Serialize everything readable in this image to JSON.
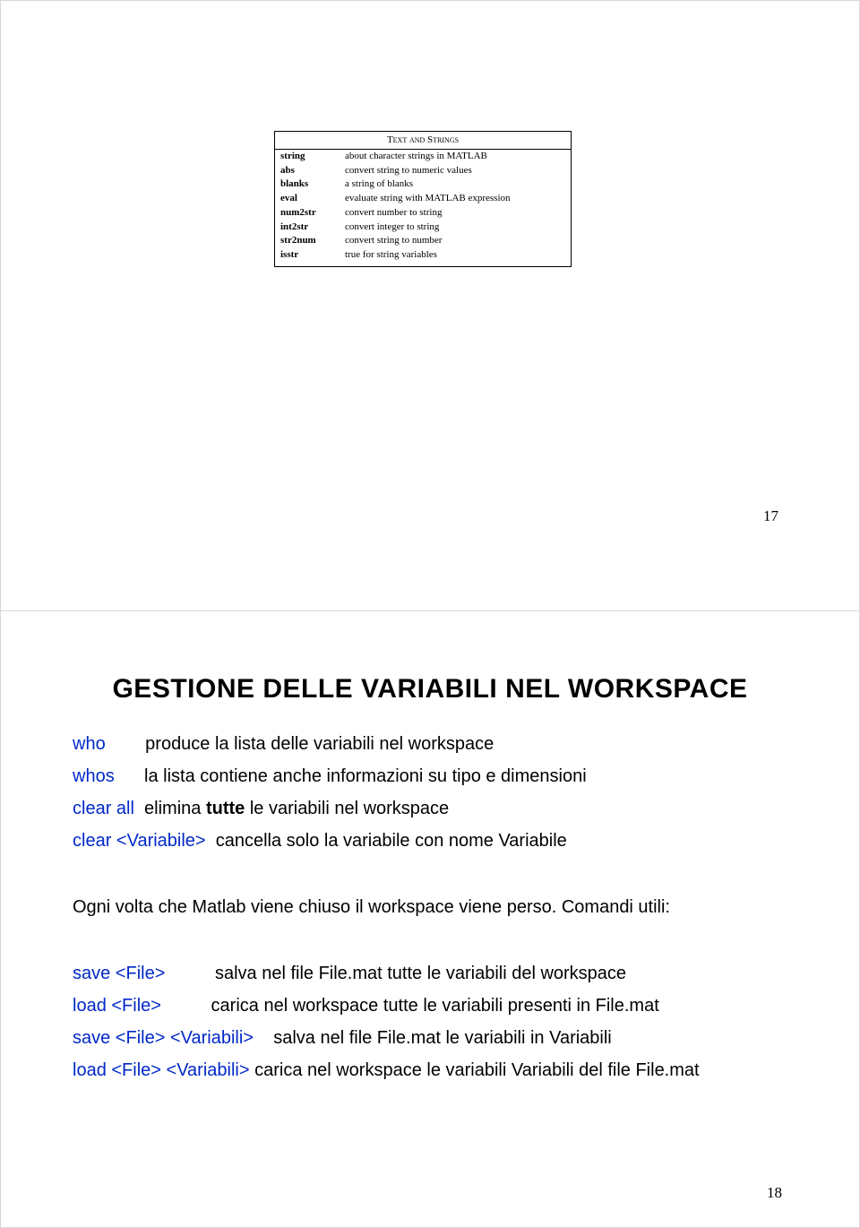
{
  "slide17": {
    "table": {
      "title": "Text and Strings",
      "rows": [
        {
          "cmd": "string",
          "desc": "about character strings in MATLAB"
        },
        {
          "cmd": "abs",
          "desc": "convert string to numeric values"
        },
        {
          "cmd": "blanks",
          "desc": "a string of blanks"
        },
        {
          "cmd": "eval",
          "desc": "evaluate string with MATLAB expression"
        },
        {
          "cmd": "num2str",
          "desc": "convert number to string"
        },
        {
          "cmd": "int2str",
          "desc": "convert integer to string"
        },
        {
          "cmd": "str2num",
          "desc": "convert string to number"
        },
        {
          "cmd": "isstr",
          "desc": "true for string variables"
        }
      ]
    },
    "page_number": "17"
  },
  "slide18": {
    "title": "GESTIONE DELLE VARIABILI NEL WORKSPACE",
    "lines": {
      "who_cmd": "who",
      "who_desc": "produce la lista delle variabili nel workspace",
      "whos_cmd": "whos",
      "whos_desc": "la lista contiene anche informazioni su tipo e dimensioni",
      "clearall_cmd": "clear all",
      "clearall_desc_pre": "  elimina ",
      "clearall_bold": "tutte",
      "clearall_desc_post": " le variabili nel workspace",
      "clearvar_cmd": "clear <Variabile>",
      "clearvar_desc": "  cancella solo la variabile con nome Variabile"
    },
    "paragraph": "Ogni volta che Matlab viene chiuso il workspace viene perso. Comandi utili:",
    "lines2": {
      "save_cmd": "save <File>",
      "save_desc": "          salva nel file File.mat tutte le variabili del workspace",
      "load_cmd": "load <File>",
      "load_desc": "          carica nel workspace tutte le variabili presenti in File.mat",
      "savev_cmd": "save <File> <Variabili>",
      "savev_desc": "    salva nel file File.mat le variabili in Variabili",
      "loadv_cmd": "load <File> <Variabili>",
      "loadv_desc": " carica nel workspace le variabili Variabili del file File.mat"
    },
    "page_number": "18"
  }
}
